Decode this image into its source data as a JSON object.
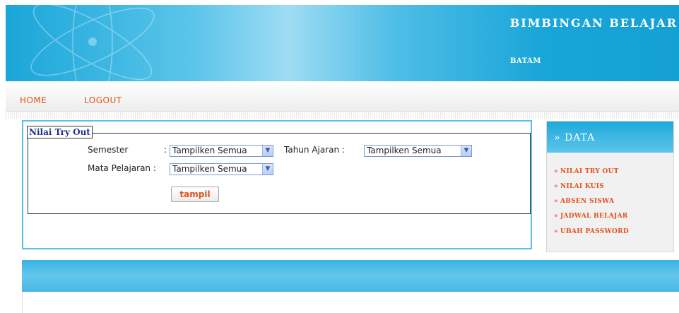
{
  "header": {
    "title": "BIMBINGAN BELAJAR",
    "subtitle": "BATAM",
    "brand_color": "#1aa6d9"
  },
  "nav": {
    "home": "HOME",
    "logout": "LOGOUT",
    "link_color": "#e0521a"
  },
  "form": {
    "legend": "Nilai Try Out",
    "semester_label": "Semester",
    "semester_sep": ":",
    "semester_value": "Tampilken Semua",
    "tahun_label": "Tahun Ajaran :",
    "tahun_value": "Tampilken Semua",
    "mapel_label": "Mata Pelajaran :",
    "mapel_value": "Tampilken Semua",
    "submit_label": "tampil"
  },
  "sidebar": {
    "title": "» DATA",
    "items": [
      {
        "label": "NILAI TRY OUT"
      },
      {
        "label": "NILAI KUIS"
      },
      {
        "label": "ABSEN SISWA"
      },
      {
        "label": "JADWAL BELAJAR"
      },
      {
        "label": "UBAH PASSWORD"
      }
    ]
  }
}
